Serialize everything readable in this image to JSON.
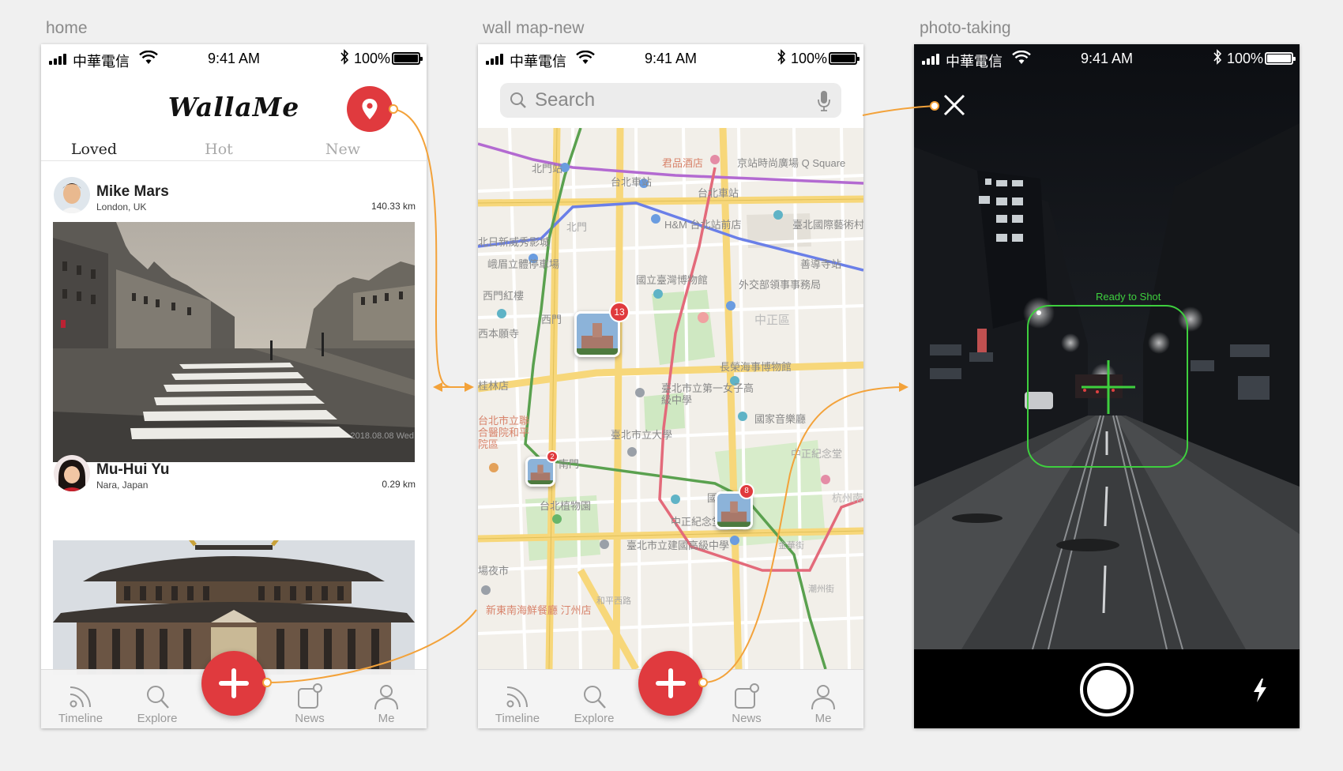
{
  "artboards": {
    "home": "home",
    "wallmap": "wall map-new",
    "camera": "photo-taking"
  },
  "status_bar": {
    "carrier": "中華電信",
    "time": "9:41 AM",
    "battery": "100%"
  },
  "home": {
    "logo": "WallaMe",
    "tabs": [
      "Loved",
      "Hot",
      "New"
    ],
    "active_tab": "Loved",
    "posts": [
      {
        "name": "Mike Mars",
        "location": "London, UK",
        "distance": "140.33 km",
        "date": "2018.08.08 Wed"
      },
      {
        "name": "Mu-Hui Yu",
        "location": "Nara, Japan",
        "distance": "0.29 km"
      }
    ]
  },
  "tabbar": {
    "items": [
      "Timeline",
      "Explore",
      "News",
      "Me"
    ]
  },
  "map": {
    "search_placeholder": "Search",
    "labels": [
      "北門站",
      "君品酒店",
      "京站時尚廣場 Q Square",
      "台北車站",
      "台北車站",
      "H&M 台北站前店",
      "臺北國際藝術村",
      "北門",
      "北日新威秀影城",
      "峨眉立體停車場",
      "善導寺站",
      "國立臺灣博物館",
      "外交部領事事務局",
      "西門紅樓",
      "西門",
      "西本願寺",
      "中正區",
      "長榮海事博物館",
      "臺北市立第一女子高級中學",
      "桂林店",
      "台北市立聯合醫院和平院區",
      "臺北市立大學",
      "國家音樂廳",
      "中正紀念堂",
      "台北植物園",
      "國立",
      "中正紀念堂",
      "杭州南路",
      "臺北市立建國高級中學",
      "場夜市",
      "新東南海鮮餐廳 汀州店",
      "和平西路",
      "金華街",
      "潮州街",
      "南門"
    ],
    "clusters": [
      {
        "count": "13"
      },
      {
        "count": "2"
      },
      {
        "count": "8"
      }
    ],
    "colors": {
      "mrt_green": "#5aa14f",
      "mrt_blue": "#6a7fe8",
      "mrt_red": "#e36a7a",
      "mrt_purple": "#b36ad1",
      "road": "#f7d77a"
    }
  },
  "camera": {
    "focus_label": "Ready to Shot"
  },
  "colors": {
    "accent": "#e03a3e",
    "flow": "#f3a23a",
    "focus": "#3ecf3e"
  },
  "icons": [
    "location-pin-icon",
    "plus-icon",
    "timeline-icon",
    "search-icon",
    "news-icon",
    "person-icon",
    "microphone-icon",
    "close-icon",
    "shutter-icon",
    "flash-icon",
    "wifi-icon",
    "bluetooth-icon",
    "battery-icon"
  ]
}
